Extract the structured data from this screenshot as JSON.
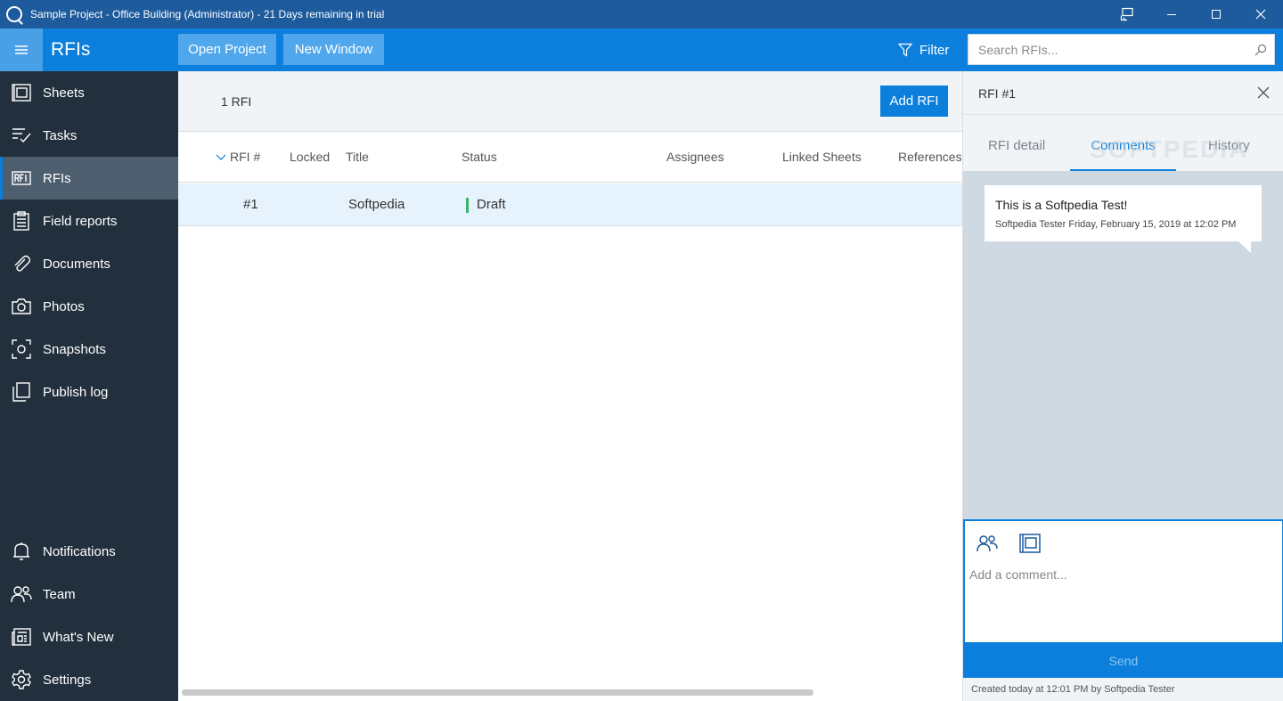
{
  "window": {
    "title": "Sample Project - Office Building (Administrator) - 21 Days remaining in trial"
  },
  "header": {
    "module_title": "RFIs",
    "open_project_label": "Open Project",
    "new_window_label": "New Window",
    "filter_label": "Filter",
    "search_placeholder": "Search RFIs..."
  },
  "sidebar": {
    "items": [
      {
        "label": "Sheets",
        "icon": "sheets-icon"
      },
      {
        "label": "Tasks",
        "icon": "tasks-icon"
      },
      {
        "label": "RFIs",
        "icon": "rfi-icon",
        "active": true
      },
      {
        "label": "Field reports",
        "icon": "clipboard-icon"
      },
      {
        "label": "Documents",
        "icon": "paperclip-icon"
      },
      {
        "label": "Photos",
        "icon": "camera-icon"
      },
      {
        "label": "Snapshots",
        "icon": "snapshot-icon"
      },
      {
        "label": "Publish log",
        "icon": "publish-log-icon"
      }
    ],
    "bottom_items": [
      {
        "label": "Notifications",
        "icon": "bell-icon"
      },
      {
        "label": "Team",
        "icon": "team-icon"
      },
      {
        "label": "What's New",
        "icon": "news-icon"
      },
      {
        "label": "Settings",
        "icon": "gear-icon"
      }
    ]
  },
  "list": {
    "count": "1 RFI",
    "add_label": "Add RFI",
    "columns": [
      "RFI #",
      "Locked",
      "Title",
      "Status",
      "Assignees",
      "Linked Sheets",
      "References"
    ],
    "rows": [
      {
        "number": "#1",
        "locked": "",
        "title": "Softpedia",
        "status": "Draft",
        "status_color": "#3bb36b"
      }
    ]
  },
  "panel": {
    "title": "RFI #1",
    "tabs": [
      "RFI detail",
      "Comments",
      "History"
    ],
    "active_tab": "Comments",
    "comment": {
      "text": "This is a Softpedia Test!",
      "meta": "Softpedia Tester Friday, February 15, 2019 at 12:02 PM"
    },
    "composer_placeholder": "Add a comment...",
    "send_label": "Send",
    "created": "Created today at 12:01 PM by Softpedia Tester",
    "watermark": "SOFTPEDIA"
  },
  "colors": {
    "accent": "#0b7fdb",
    "titlebar": "#1d5b9c",
    "sidebar": "#22303d",
    "sidebar_active": "#4d5e6f",
    "draft_status": "#3bb36b"
  }
}
